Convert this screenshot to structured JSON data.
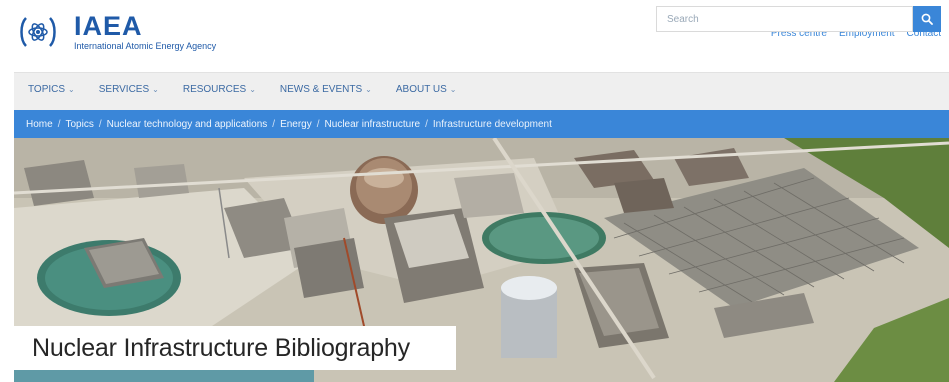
{
  "brand": {
    "name": "IAEA",
    "subtitle": "International Atomic Energy Agency"
  },
  "utility_links": [
    "Press centre",
    "Employment",
    "Contact"
  ],
  "nav": {
    "items": [
      {
        "label": "TOPICS"
      },
      {
        "label": "SERVICES"
      },
      {
        "label": "RESOURCES"
      },
      {
        "label": "NEWS & EVENTS"
      },
      {
        "label": "ABOUT US"
      }
    ]
  },
  "search": {
    "placeholder": "Search"
  },
  "breadcrumb": [
    "Home",
    "Topics",
    "Nuclear technology and applications",
    "Energy",
    "Nuclear infrastructure",
    "Infrastructure development"
  ],
  "hero": {
    "title": "Nuclear Infrastructure Bibliography"
  },
  "icons": {
    "logo": "iaea-logo-icon",
    "search": "search-icon",
    "chevron": "chevron-down-icon"
  },
  "colors": {
    "brand_blue": "#1f5aa8",
    "accent_blue": "#3a86d8",
    "nav_bg": "#efefef"
  }
}
